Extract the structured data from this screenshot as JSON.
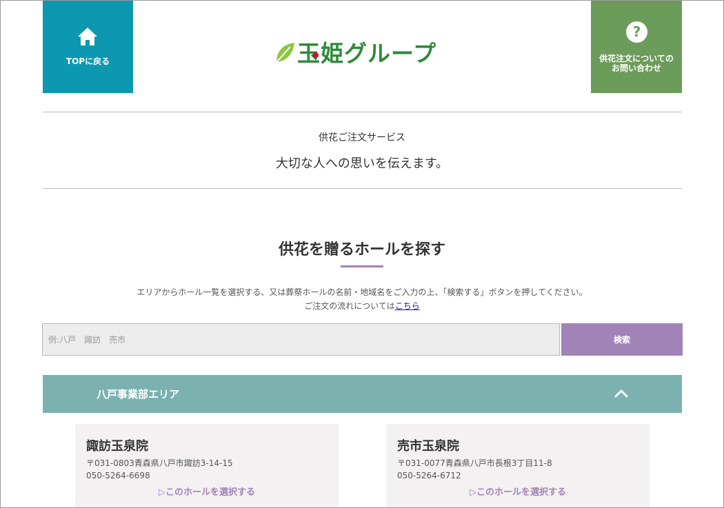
{
  "header": {
    "top_label": "TOPに戻る",
    "help_label_line1": "供花注文についての",
    "help_label_line2": "お問い合わせ",
    "help_icon_char": "?",
    "logo_text": "玉姫グループ",
    "top_bg": "#0b98b0",
    "help_bg": "#6c9c59"
  },
  "tagline": {
    "small": "供花ご注文サービス",
    "big": "大切な人への思いを伝えます。"
  },
  "search_section": {
    "title": "供花を贈るホールを探す",
    "instruction": "エリアからホール一覧を選択する、又は葬祭ホールの名前・地域名をご入力の上、「検索する」ボタンを押してください。",
    "flow_prefix": "ご注文の流れについては",
    "flow_link": "こちら",
    "placeholder": "例:八戸　諏訪　売市",
    "value": "",
    "button": "検索",
    "accent": "#a283b8"
  },
  "area": {
    "name": "八戸事業部エリア",
    "bg": "#7bb2b0",
    "halls": [
      {
        "name": "諏訪玉泉院",
        "address": "〒031-0803青森県八戸市諏訪3-14-15",
        "tel": "050-5264-6698",
        "select": "▷このホールを選択する"
      },
      {
        "name": "売市玉泉院",
        "address": "〒031-0077青森県八戸市長根3丁目11-8",
        "tel": "050-5264-6712",
        "select": "▷このホールを選択する"
      }
    ]
  }
}
